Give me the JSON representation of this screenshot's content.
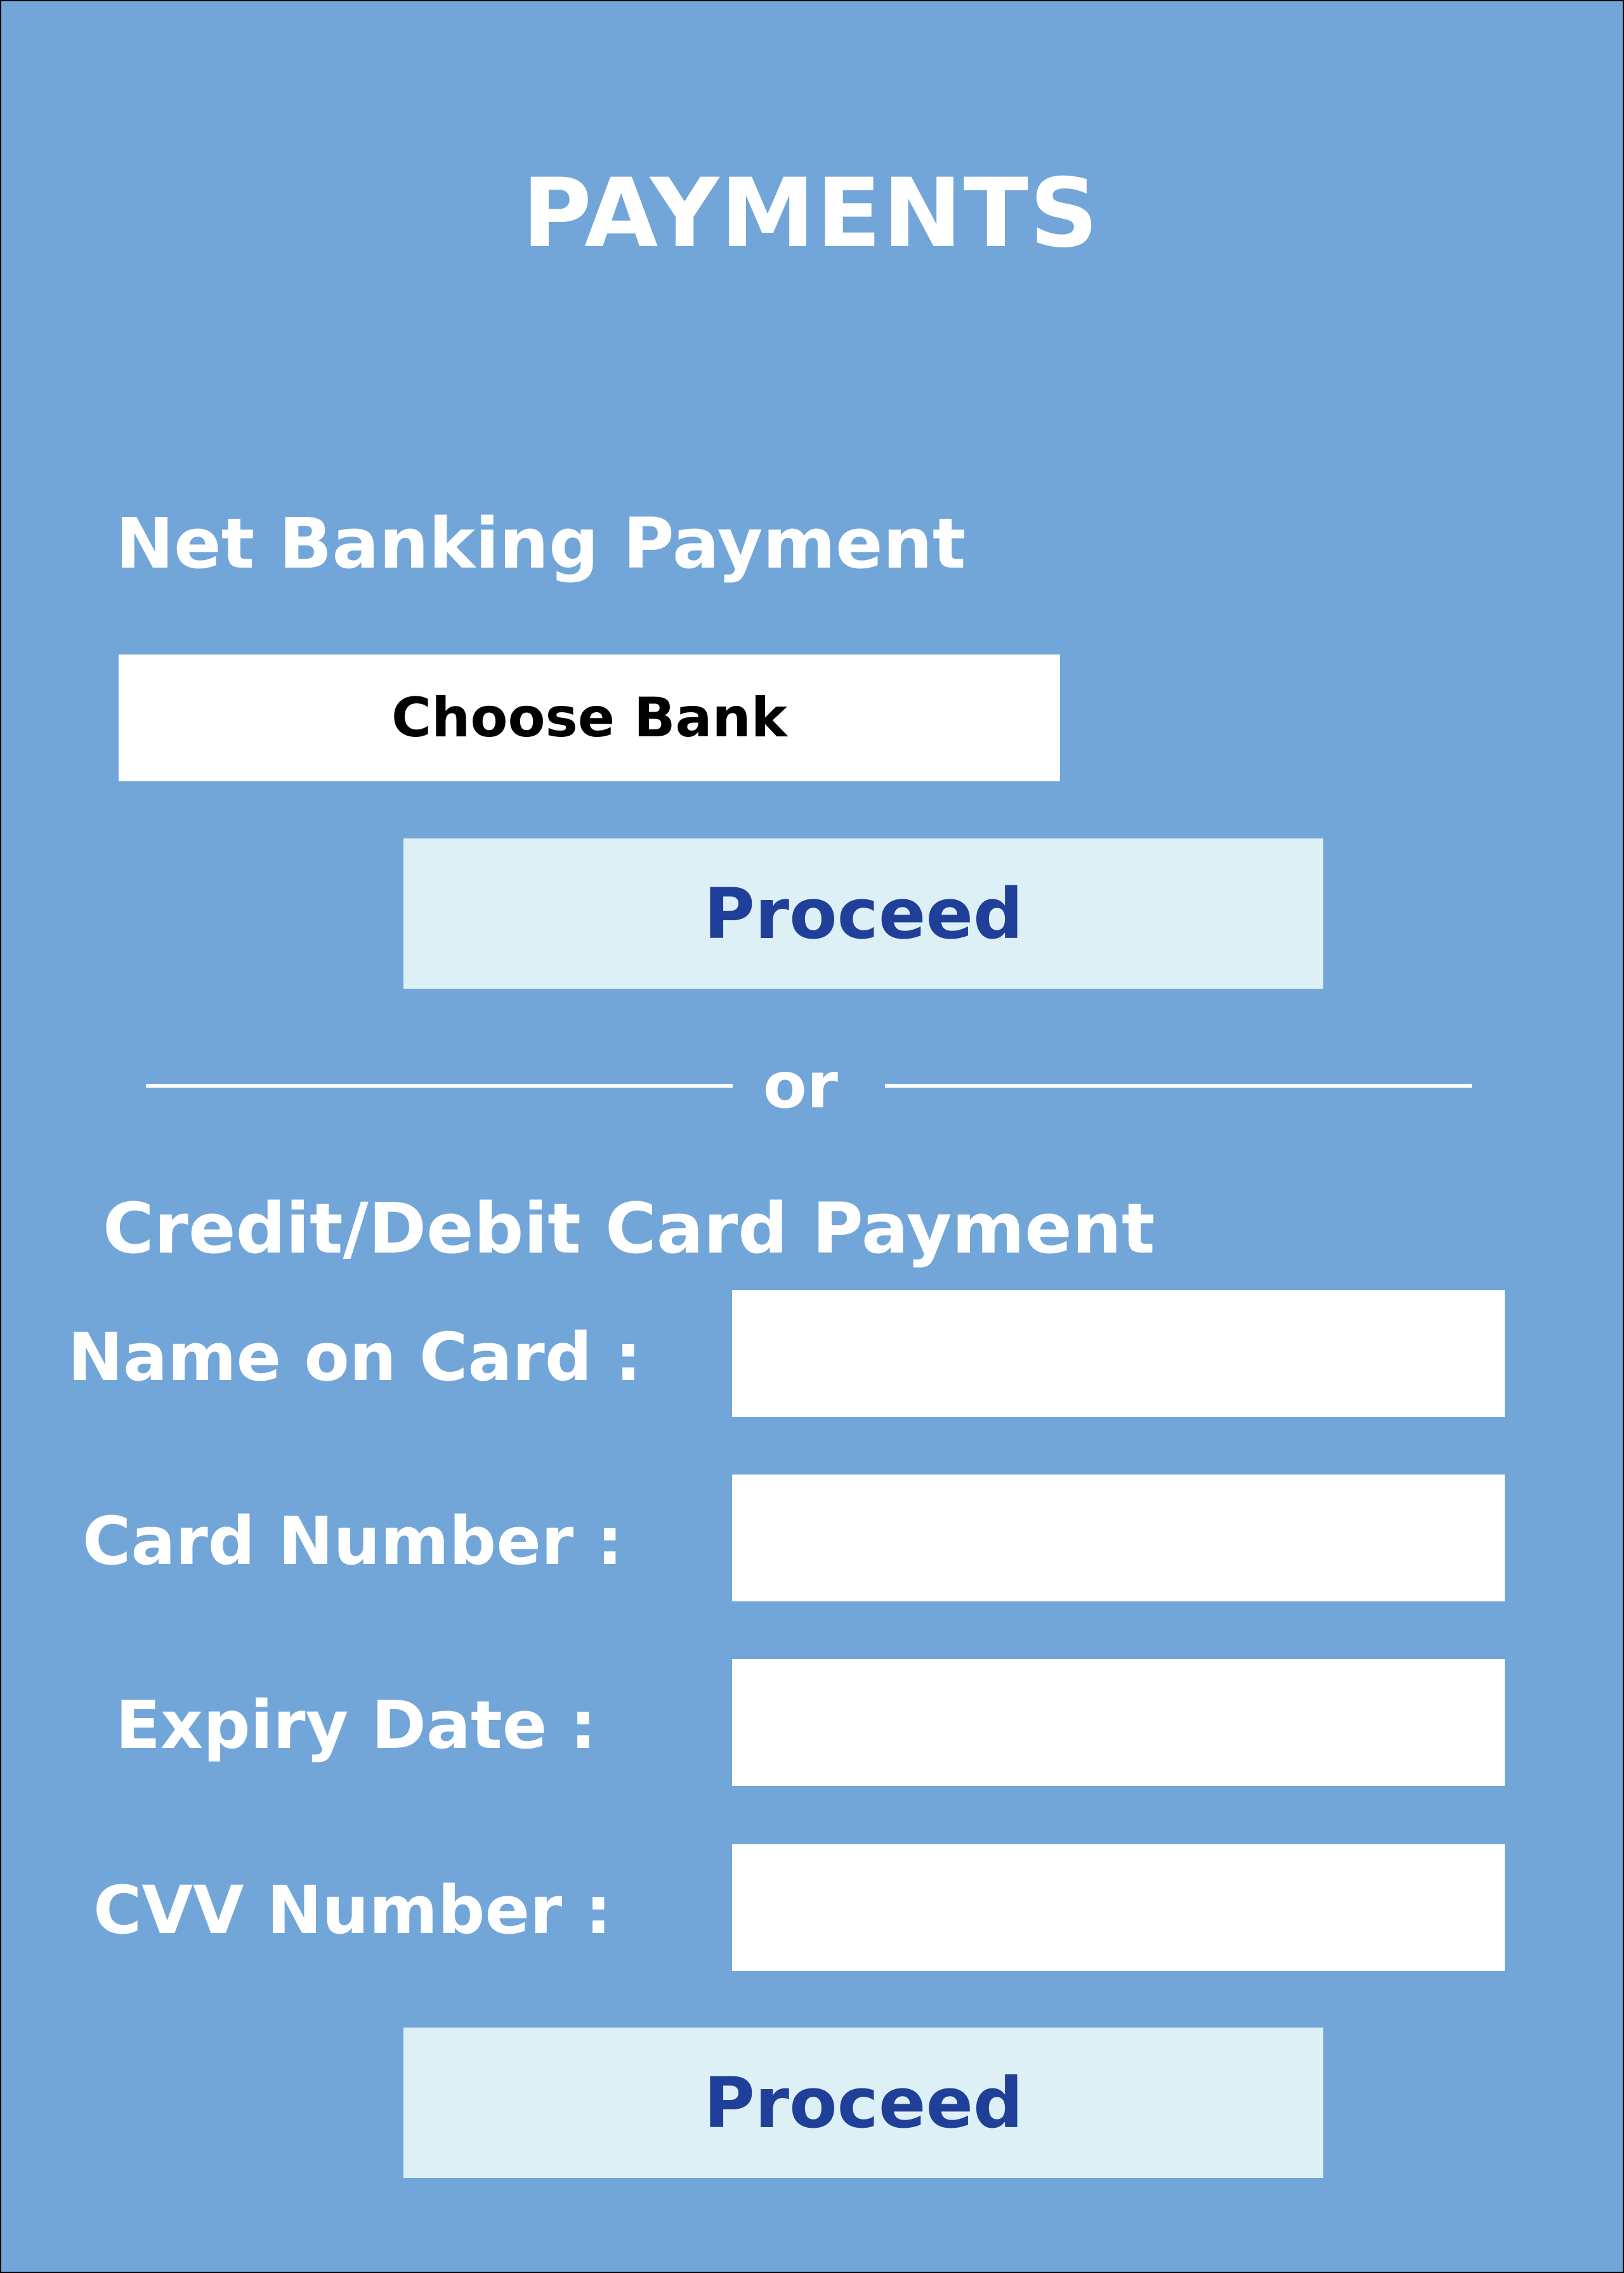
{
  "page": {
    "title": "PAYMENTS"
  },
  "net_banking": {
    "heading": "Net Banking Payment",
    "bank_select_label": "Choose Bank",
    "proceed_label": "Proceed"
  },
  "separator": {
    "text": "or"
  },
  "card_payment": {
    "heading": "Credit/Debit Card Payment",
    "fields": [
      {
        "label": "Name on Card :",
        "value": ""
      },
      {
        "label": "Card Number :",
        "value": ""
      },
      {
        "label": "Expiry Date :",
        "value": ""
      },
      {
        "label": "CVV Number :",
        "value": ""
      }
    ],
    "proceed_label": "Proceed"
  },
  "colors": {
    "background": "#72a6d9",
    "text": "#ffffff",
    "button_bg": "#ddf0f5",
    "button_text": "#1f3f99",
    "input_bg": "#ffffff"
  }
}
